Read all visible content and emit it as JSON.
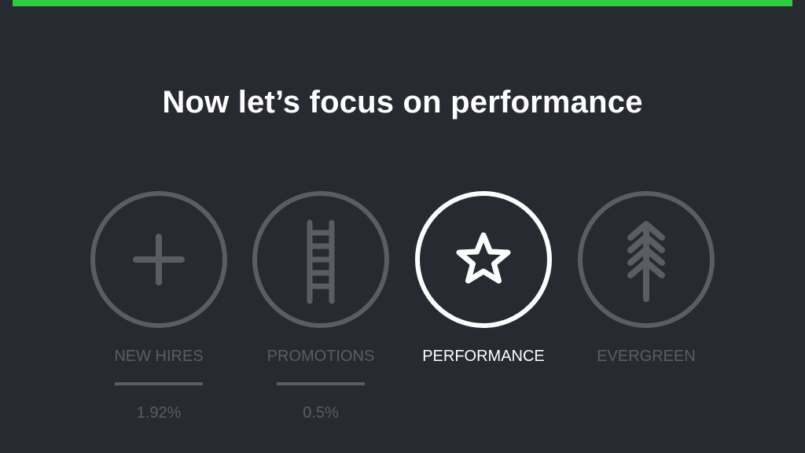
{
  "progress": {
    "color": "#2ecc40"
  },
  "heading": "Now let’s focus on performance",
  "steps": [
    {
      "label": "NEW HIRES",
      "value": "1.92%",
      "icon": "plus-icon",
      "active": false
    },
    {
      "label": "PROMOTIONS",
      "value": "0.5%",
      "icon": "ladder-icon",
      "active": false
    },
    {
      "label": "PERFORMANCE",
      "icon": "star-icon",
      "active": true
    },
    {
      "label": "EVERGREEN",
      "icon": "evergreen-tree-icon",
      "active": false
    }
  ],
  "colors": {
    "background": "#282a32",
    "inactive": "#5c5d62",
    "active": "#ffffff"
  }
}
